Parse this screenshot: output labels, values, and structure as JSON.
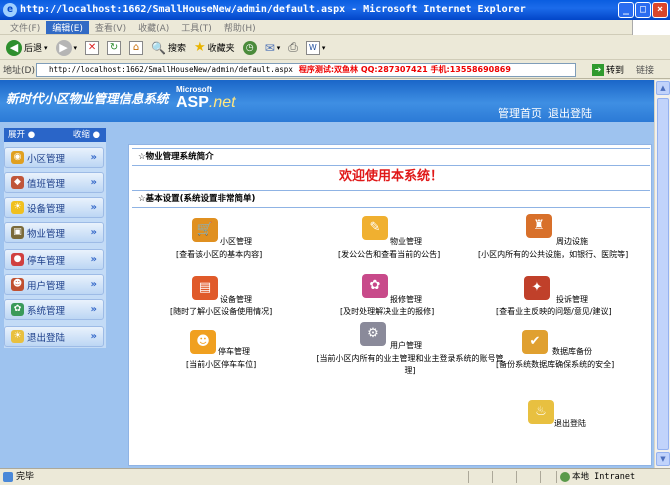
{
  "window": {
    "title": "http://localhost:1662/SmallHouseNew/admin/default.aspx - Microsoft Internet Explorer"
  },
  "menu": [
    "文件(F)",
    "编辑(E)",
    "查看(V)",
    "收藏(A)",
    "工具(T)",
    "帮助(H)"
  ],
  "toolbar": {
    "back": "后退",
    "search": "搜索",
    "favorites": "收藏夹"
  },
  "address": {
    "label": "地址(D)",
    "url": "http://localhost:1662/SmallHouseNew/admin/default.aspx",
    "note": "程序测试:双鱼林 QQ:287307421 手机:13558690869",
    "go": "转到",
    "links": "链接"
  },
  "banner": {
    "title": "新时代小区物业管理信息系统",
    "ms": "Microsoft",
    "asp": "ASP",
    "net": ".net",
    "home": "管理首页",
    "logout": "退出登陆"
  },
  "sidebar": {
    "expand": "展开",
    "collapse": "收缩",
    "items": [
      "小区管理",
      "值班管理",
      "设备管理",
      "物业管理",
      "停车管理",
      "用户管理",
      "系统管理",
      "退出登陆"
    ]
  },
  "sections": {
    "intro": "☆物业管理系统简介",
    "welcome": "欢迎使用本系统！",
    "basic": "☆基本设置(系统设置非常简单)"
  },
  "features": [
    {
      "title": "小区管理",
      "desc": "[查看该小区的基本内容]"
    },
    {
      "title": "物业管理",
      "desc": "[发公公告和查看当前的公告]"
    },
    {
      "title": "周边设施",
      "desc": "[小区内所有的公共设施，如银行、医院等]"
    },
    {
      "title": "设备管理",
      "desc": "[随时了解小区设备使用情况]"
    },
    {
      "title": "报修管理",
      "desc": "[及时处理解决业主的报修]"
    },
    {
      "title": "投诉管理",
      "desc": "[查看业主反映的问题/意见/建议]"
    },
    {
      "title": "停车管理",
      "desc": "[当前小区停车车位]"
    },
    {
      "title": "用户管理",
      "desc": "[当前小区内所有的业主管理和业主登录系统的账号管理]"
    },
    {
      "title": "数据库备份",
      "desc": "[备份系统数据库确保系统的安全]"
    },
    {
      "title": "退出登陆",
      "desc": ""
    }
  ],
  "status": {
    "text": "完毕",
    "zone": "本地 Intranet"
  },
  "colors": {
    "welcome": "#e01818",
    "banner": "#2c7ad6",
    "sidebar": "#c3dbf6",
    "titlebar": "#0a5de0"
  }
}
